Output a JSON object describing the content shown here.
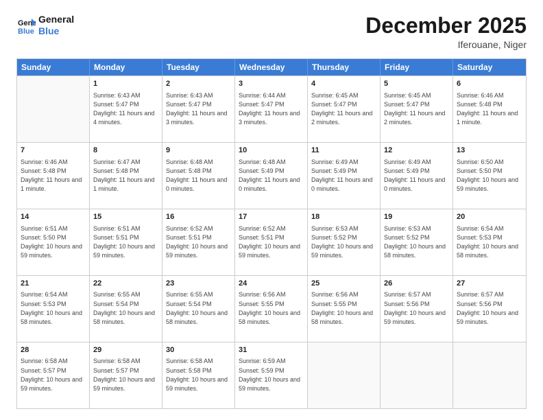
{
  "logo": {
    "line1": "General",
    "line2": "Blue"
  },
  "title": "December 2025",
  "location": "Iferouane, Niger",
  "days_of_week": [
    "Sunday",
    "Monday",
    "Tuesday",
    "Wednesday",
    "Thursday",
    "Friday",
    "Saturday"
  ],
  "weeks": [
    [
      {
        "day": "",
        "empty": true
      },
      {
        "day": "1",
        "sunrise": "6:43 AM",
        "sunset": "5:47 PM",
        "daylight": "11 hours and 4 minutes."
      },
      {
        "day": "2",
        "sunrise": "6:43 AM",
        "sunset": "5:47 PM",
        "daylight": "11 hours and 3 minutes."
      },
      {
        "day": "3",
        "sunrise": "6:44 AM",
        "sunset": "5:47 PM",
        "daylight": "11 hours and 3 minutes."
      },
      {
        "day": "4",
        "sunrise": "6:45 AM",
        "sunset": "5:47 PM",
        "daylight": "11 hours and 2 minutes."
      },
      {
        "day": "5",
        "sunrise": "6:45 AM",
        "sunset": "5:47 PM",
        "daylight": "11 hours and 2 minutes."
      },
      {
        "day": "6",
        "sunrise": "6:46 AM",
        "sunset": "5:48 PM",
        "daylight": "11 hours and 1 minute."
      }
    ],
    [
      {
        "day": "7",
        "sunrise": "6:46 AM",
        "sunset": "5:48 PM",
        "daylight": "11 hours and 1 minute."
      },
      {
        "day": "8",
        "sunrise": "6:47 AM",
        "sunset": "5:48 PM",
        "daylight": "11 hours and 1 minute."
      },
      {
        "day": "9",
        "sunrise": "6:48 AM",
        "sunset": "5:48 PM",
        "daylight": "11 hours and 0 minutes."
      },
      {
        "day": "10",
        "sunrise": "6:48 AM",
        "sunset": "5:49 PM",
        "daylight": "11 hours and 0 minutes."
      },
      {
        "day": "11",
        "sunrise": "6:49 AM",
        "sunset": "5:49 PM",
        "daylight": "11 hours and 0 minutes."
      },
      {
        "day": "12",
        "sunrise": "6:49 AM",
        "sunset": "5:49 PM",
        "daylight": "11 hours and 0 minutes."
      },
      {
        "day": "13",
        "sunrise": "6:50 AM",
        "sunset": "5:50 PM",
        "daylight": "10 hours and 59 minutes."
      }
    ],
    [
      {
        "day": "14",
        "sunrise": "6:51 AM",
        "sunset": "5:50 PM",
        "daylight": "10 hours and 59 minutes."
      },
      {
        "day": "15",
        "sunrise": "6:51 AM",
        "sunset": "5:51 PM",
        "daylight": "10 hours and 59 minutes."
      },
      {
        "day": "16",
        "sunrise": "6:52 AM",
        "sunset": "5:51 PM",
        "daylight": "10 hours and 59 minutes."
      },
      {
        "day": "17",
        "sunrise": "6:52 AM",
        "sunset": "5:51 PM",
        "daylight": "10 hours and 59 minutes."
      },
      {
        "day": "18",
        "sunrise": "6:53 AM",
        "sunset": "5:52 PM",
        "daylight": "10 hours and 59 minutes."
      },
      {
        "day": "19",
        "sunrise": "6:53 AM",
        "sunset": "5:52 PM",
        "daylight": "10 hours and 58 minutes."
      },
      {
        "day": "20",
        "sunrise": "6:54 AM",
        "sunset": "5:53 PM",
        "daylight": "10 hours and 58 minutes."
      }
    ],
    [
      {
        "day": "21",
        "sunrise": "6:54 AM",
        "sunset": "5:53 PM",
        "daylight": "10 hours and 58 minutes."
      },
      {
        "day": "22",
        "sunrise": "6:55 AM",
        "sunset": "5:54 PM",
        "daylight": "10 hours and 58 minutes."
      },
      {
        "day": "23",
        "sunrise": "6:55 AM",
        "sunset": "5:54 PM",
        "daylight": "10 hours and 58 minutes."
      },
      {
        "day": "24",
        "sunrise": "6:56 AM",
        "sunset": "5:55 PM",
        "daylight": "10 hours and 58 minutes."
      },
      {
        "day": "25",
        "sunrise": "6:56 AM",
        "sunset": "5:55 PM",
        "daylight": "10 hours and 58 minutes."
      },
      {
        "day": "26",
        "sunrise": "6:57 AM",
        "sunset": "5:56 PM",
        "daylight": "10 hours and 59 minutes."
      },
      {
        "day": "27",
        "sunrise": "6:57 AM",
        "sunset": "5:56 PM",
        "daylight": "10 hours and 59 minutes."
      }
    ],
    [
      {
        "day": "28",
        "sunrise": "6:58 AM",
        "sunset": "5:57 PM",
        "daylight": "10 hours and 59 minutes."
      },
      {
        "day": "29",
        "sunrise": "6:58 AM",
        "sunset": "5:57 PM",
        "daylight": "10 hours and 59 minutes."
      },
      {
        "day": "30",
        "sunrise": "6:58 AM",
        "sunset": "5:58 PM",
        "daylight": "10 hours and 59 minutes."
      },
      {
        "day": "31",
        "sunrise": "6:59 AM",
        "sunset": "5:59 PM",
        "daylight": "10 hours and 59 minutes."
      },
      {
        "day": "",
        "empty": true
      },
      {
        "day": "",
        "empty": true
      },
      {
        "day": "",
        "empty": true
      }
    ]
  ]
}
